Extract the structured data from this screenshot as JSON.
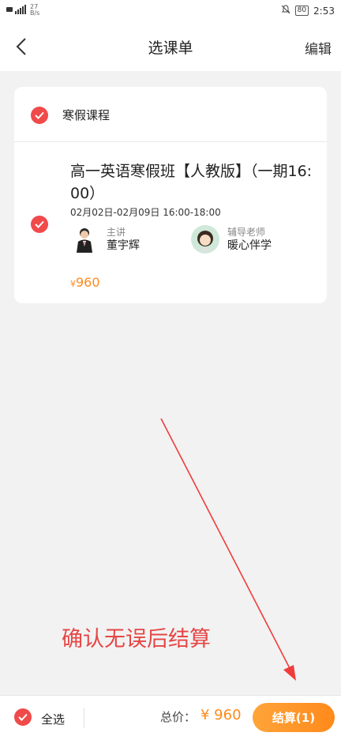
{
  "status_bar": {
    "network": "4G",
    "speed_value": "27",
    "speed_unit": "B/s",
    "battery": "80",
    "time": "2:53"
  },
  "nav": {
    "back_icon": "chevron-left",
    "title": "选课单",
    "edit_label": "编辑"
  },
  "card": {
    "section_title": "寒假课程",
    "course": {
      "title": "高一英语寒假班【人教版】（一期16:00）",
      "date_range": "02月02日-02月09日 16:00-18:00",
      "main_teacher_role": "主讲",
      "main_teacher_name": "董宇辉",
      "tutor_role": "辅导老师",
      "tutor_name": "暖心伴学",
      "price_symbol": "¥",
      "price_value": "960"
    }
  },
  "annotation": {
    "text": "确认无误后结算",
    "color": "#e64545"
  },
  "footer": {
    "select_all_label": "全选",
    "total_label": "总价：",
    "total_value": "¥ 960",
    "checkout_label": "结算(1)"
  },
  "colors": {
    "accent": "#ff8a1a",
    "check_red": "#f04a4a",
    "background": "#f2f2f2"
  }
}
